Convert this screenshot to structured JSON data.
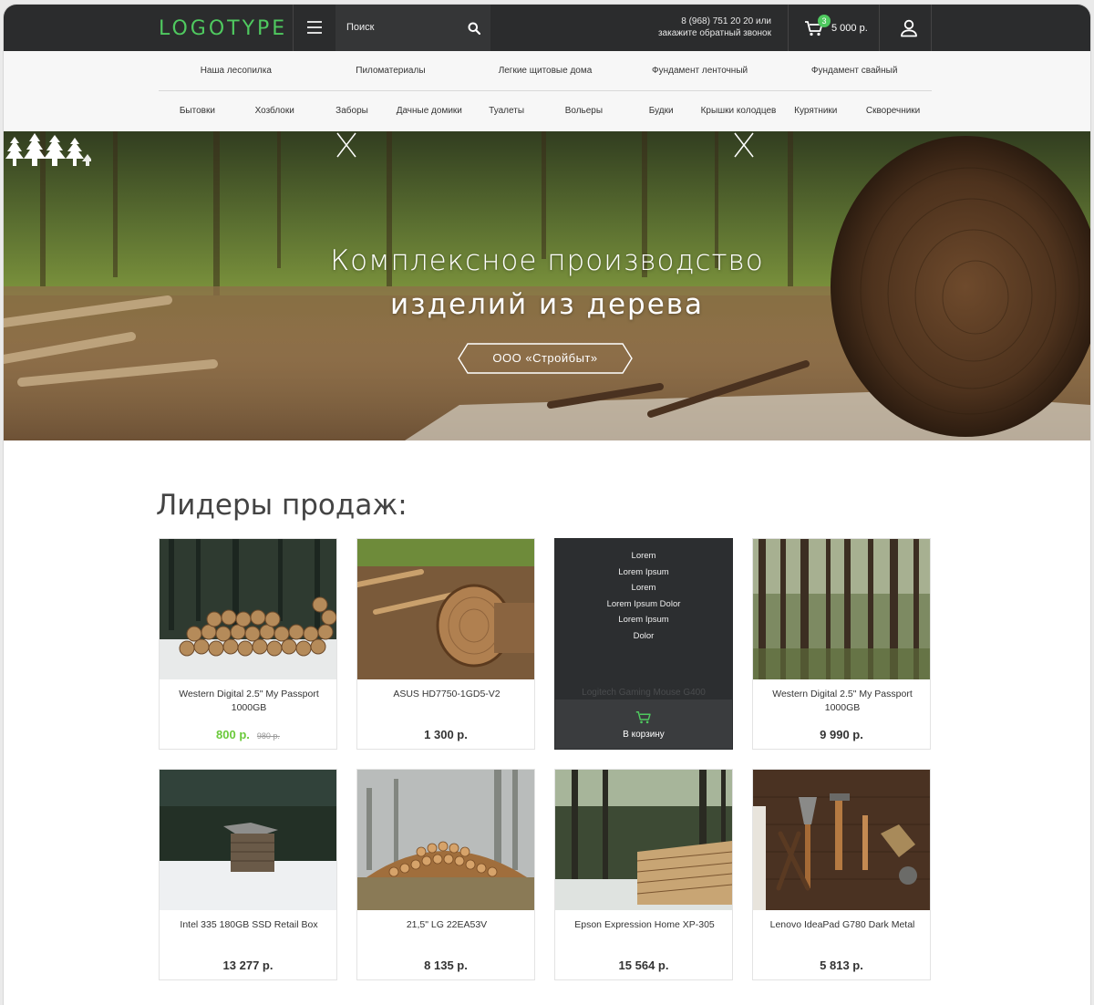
{
  "header": {
    "logo": "LOGOTYPE",
    "search_placeholder": "Поиск",
    "phone_line1": "8 (968) 751 20 20 или",
    "phone_line2": "закажите обратный звонок",
    "cart_count": "3",
    "cart_total": "5 000 р."
  },
  "nav": {
    "row1": [
      "Наша лесопилка",
      "Пиломатериалы",
      "Легкие щитовые дома",
      "Фундамент ленточный",
      "Фундамент свайный"
    ],
    "row2": [
      "Бытовки",
      "Хозблоки",
      "Заборы",
      "Дачные домики",
      "Туалеты",
      "Вольеры",
      "Будки",
      "Крышки колодцев",
      "Курятники",
      "Скворечники"
    ]
  },
  "hero": {
    "line1": "Комплексное производство",
    "line2": "изделий из дерева",
    "badge": "ООО «Стройбыт»"
  },
  "section_title": "Лидеры продаж:",
  "products": [
    {
      "title": "Western Digital 2.5\" My Passport 1000GB",
      "price": "800 р.",
      "old_price": "980 р.",
      "image": "log-pile-snow"
    },
    {
      "title": "ASUS HD7750-1GD5-V2",
      "price": "1 300 р.",
      "image": "cut-logs-forest"
    },
    {
      "title": "Logitech Gaming Mouse G400",
      "price": "",
      "image": "dark-hover",
      "hover_menu": [
        "Lorem",
        "Lorem Ipsum",
        "Lorem",
        "Lorem Ipsum Dolor",
        "Lorem Ipsum",
        "Dolor"
      ],
      "cart_label": "В корзину"
    },
    {
      "title": "Western Digital 2.5\" My Passport 1000GB",
      "price": "9 990 р.",
      "image": "pine-forest"
    },
    {
      "title": "Intel 335 180GB SSD Retail Box",
      "price": "13 277 р.",
      "image": "cabin-snow"
    },
    {
      "title": "21,5\" LG 22EA53V",
      "price": "8 135 р.",
      "image": "misty-log-pile"
    },
    {
      "title": "Epson Expression Home XP-305",
      "price": "15 564 р.",
      "image": "firewood-forest"
    },
    {
      "title": "Lenovo IdeaPad G780 Dark Metal",
      "price": "5 813 р.",
      "image": "tools-wood"
    }
  ],
  "colors": {
    "accent": "#4fc95f",
    "price_green": "#6ac93a",
    "topbar": "#2b2c2d"
  }
}
